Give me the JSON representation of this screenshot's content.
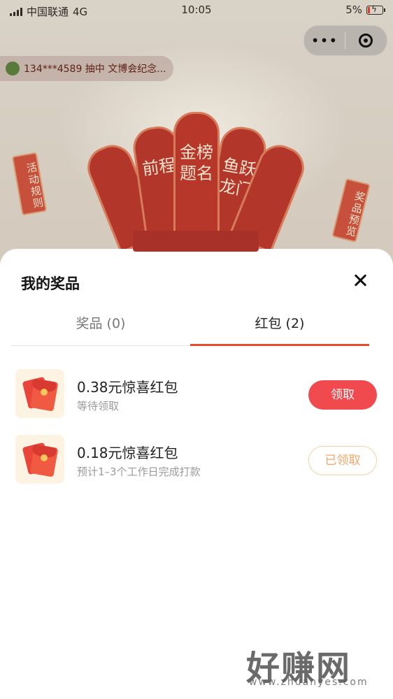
{
  "status_bar": {
    "carrier": "中国联通",
    "network": "4G",
    "time": "10:05",
    "battery": "5%"
  },
  "background": {
    "ticker_text": "134***4589 抽中 文博会纪念...",
    "left_tag": "活动规则",
    "right_tag": "奖品预览",
    "fan_cards": [
      "前程",
      "金榜题名",
      "鱼跃龙门"
    ]
  },
  "sheet": {
    "title": "我的奖品",
    "tabs": [
      {
        "label": "奖品 (0)"
      },
      {
        "label": "红包 (2)"
      }
    ],
    "active_tab": 1,
    "items": [
      {
        "title": "0.38元惊喜红包",
        "subtitle": "等待领取",
        "action": "领取",
        "claimed": false
      },
      {
        "title": "0.18元惊喜红包",
        "subtitle": "预计1–3个工作日完成打款",
        "action": "已领取",
        "claimed": true
      }
    ]
  },
  "watermark": {
    "text": "好赚网",
    "url": "www.zhuanyes.com"
  },
  "colors": {
    "accent": "#ea4a2c",
    "claim_button": "#f04a4e",
    "claimed_text": "#f2a769"
  }
}
